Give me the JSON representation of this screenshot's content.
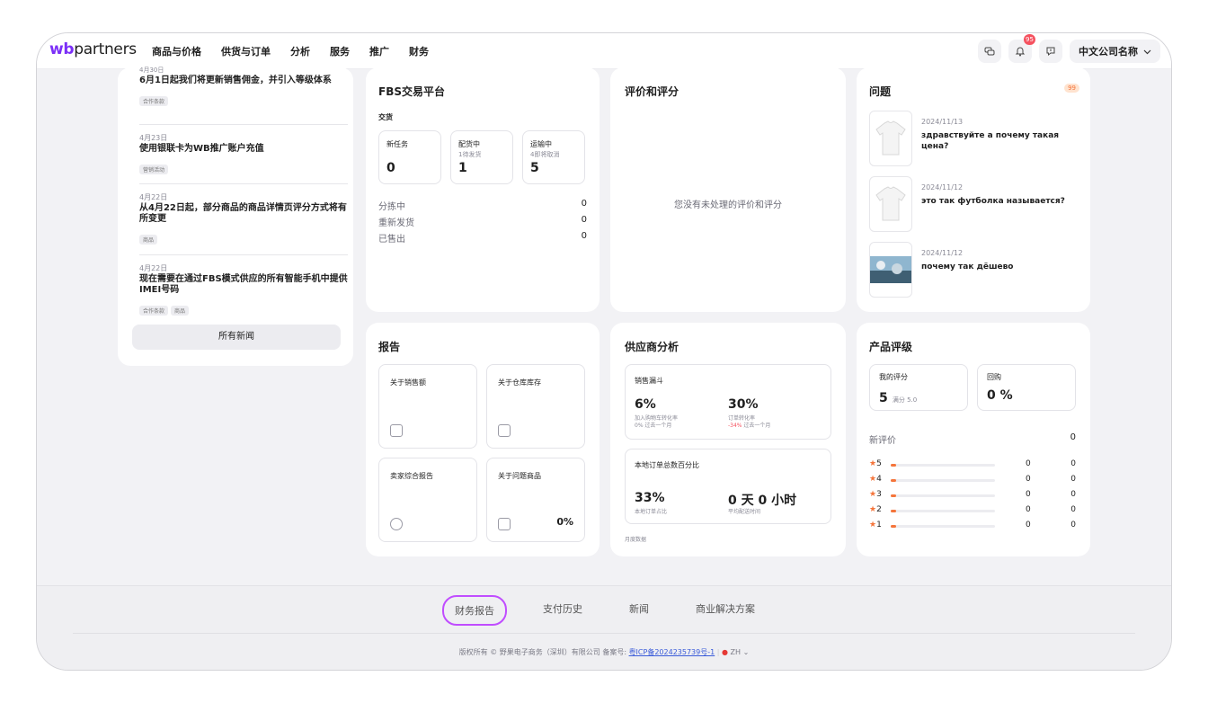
{
  "header": {
    "logo_wb": "wb",
    "logo_partners": "partners",
    "nav": [
      "商品与价格",
      "供货与订单",
      "分析",
      "服务",
      "推广",
      "财务"
    ],
    "notification_count": "95",
    "company": "中文公司名称"
  },
  "news": {
    "top_cut_date": "4月30日",
    "items": [
      {
        "date": "",
        "title": "6月1日起我们将更新销售佣金，并引入等级体系",
        "tags": [
          "合作条款"
        ]
      },
      {
        "date": "4月23日",
        "title": "使用银联卡为WB推广账户充值",
        "tags": [
          "营销活动"
        ]
      },
      {
        "date": "4月22日",
        "title": "从4月22日起，部分商品的商品详情页评分方式将有所变更",
        "tags": [
          "商品"
        ]
      },
      {
        "date": "4月22日",
        "title": "现在需要在通过FBS模式供应的所有智能手机中提供IMEI号码",
        "tags": [
          "合作条款",
          "商品"
        ]
      }
    ],
    "all_news_label": "所有新闻"
  },
  "fbs": {
    "title": "FBS交易平台",
    "delivery_label": "交货",
    "boxes": [
      {
        "label": "新任务",
        "sub": "",
        "value": "0"
      },
      {
        "label": "配货中",
        "sub": "1待发货",
        "value": "1"
      },
      {
        "label": "运输中",
        "sub": "4即将取消",
        "value": "5"
      }
    ],
    "rows": [
      {
        "label": "分拣中",
        "value": "0"
      },
      {
        "label": "重新发货",
        "value": "0"
      },
      {
        "label": "已售出",
        "value": "0"
      }
    ]
  },
  "reviews": {
    "title": "评价和评分",
    "empty": "您没有未处理的评价和评分"
  },
  "questions": {
    "title": "问题",
    "count": "99",
    "items": [
      {
        "date": "2024/11/13",
        "text": "здравствуйте а почему такая цена?"
      },
      {
        "date": "2024/11/12",
        "text": "это так футболка называется?"
      },
      {
        "date": "2024/11/12",
        "text": "почему так дёшево"
      }
    ]
  },
  "reports": {
    "title": "报告",
    "items": [
      {
        "label": "关于销售额",
        "extra": ""
      },
      {
        "label": "关于仓库库存",
        "extra": ""
      },
      {
        "label": "卖家综合报告",
        "extra": ""
      },
      {
        "label": "关于问题商品",
        "extra": "0%"
      }
    ]
  },
  "analytics": {
    "title": "供应商分析",
    "funnel_title": "销售漏斗",
    "m1_value": "6%",
    "m1_label": "加入购物车转化率",
    "m1_sub": "0% 过去一个月",
    "m2_value": "30%",
    "m2_label": "订单转化率",
    "m2_sub_red": "-34%",
    "m2_sub": " 过去一个月",
    "local_title": "本地订单总数百分比",
    "m3_value": "33%",
    "m3_label": "本地订单占比",
    "m4_value": "0 天 0 小时",
    "m4_label": "平均配送时间",
    "monthly": "月度数据"
  },
  "rating": {
    "title": "产品评级",
    "my_label": "我的评分",
    "my_value": "5",
    "my_max": "满分 5.0",
    "rebuy_label": "回购",
    "rebuy_value": "0 %",
    "new_label": "新评价",
    "new_value": "0",
    "rows": [
      {
        "stars": "5",
        "a": "0",
        "b": "0"
      },
      {
        "stars": "4",
        "a": "0",
        "b": "0"
      },
      {
        "stars": "3",
        "a": "0",
        "b": "0"
      },
      {
        "stars": "2",
        "a": "0",
        "b": "0"
      },
      {
        "stars": "1",
        "a": "0",
        "b": "0"
      }
    ]
  },
  "footer": {
    "links": [
      "财务报告",
      "支付历史",
      "新闻",
      "商业解决方案"
    ],
    "copyright": "版权所有 © 野果电子商务（深圳）有限公司 备案号: ",
    "icp": "粤ICP备2024235739号-1",
    "lang": "ZH"
  },
  "colors": {
    "brand": "#7b2ff7",
    "accent": "#f5753b",
    "highlight": "#c04dff",
    "badge": "#f5515f"
  }
}
